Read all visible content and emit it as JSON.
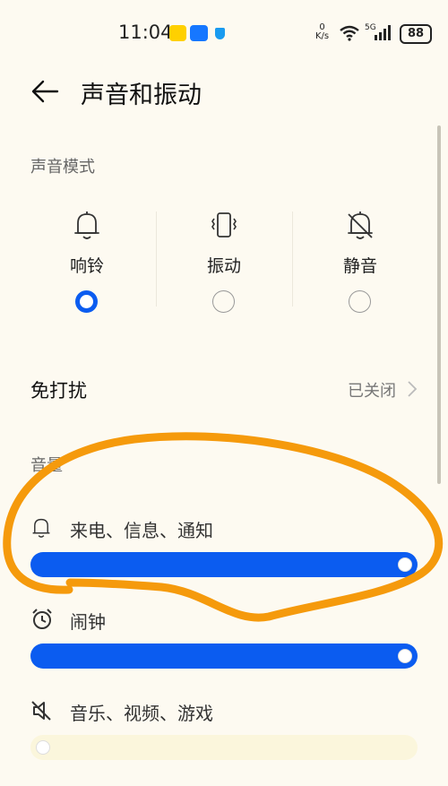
{
  "status_bar": {
    "time": "11:04",
    "net_speed_value": "0",
    "net_speed_unit": "K/s",
    "network_type": "5G",
    "battery": "88",
    "apps": [
      "美团",
      "支付宝"
    ]
  },
  "header": {
    "title": "声音和振动"
  },
  "sound_mode": {
    "label": "声音模式",
    "options": [
      {
        "label": "响铃",
        "icon": "bell-icon",
        "selected": true
      },
      {
        "label": "振动",
        "icon": "vibrate-icon",
        "selected": false
      },
      {
        "label": "静音",
        "icon": "bell-off-icon",
        "selected": false
      }
    ],
    "accent_color": "#0b5cf0"
  },
  "do_not_disturb": {
    "label": "免打扰",
    "value": "已关闭"
  },
  "volume": {
    "label": "音量",
    "items": [
      {
        "label": "来电、信息、通知",
        "icon": "bell-icon",
        "level": 1.0
      },
      {
        "label": "闹钟",
        "icon": "alarm-clock-icon",
        "level": 1.0
      },
      {
        "label": "音乐、视频、游戏",
        "icon": "speaker-muted-icon",
        "level": 0.0
      }
    ]
  }
}
